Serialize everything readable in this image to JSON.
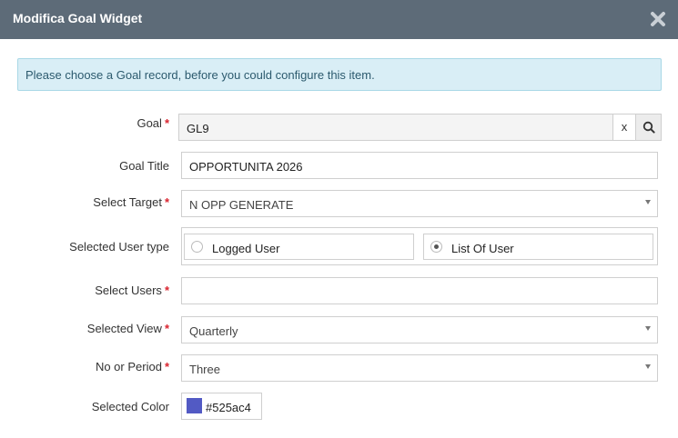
{
  "dialog": {
    "title": "Modifica Goal Widget",
    "alert": "Please choose a Goal record, before you could configure this item."
  },
  "form": {
    "goal": {
      "label": "Goal",
      "value": "GL9",
      "clear": "x"
    },
    "goal_title": {
      "label": "Goal Title",
      "value": "OPPORTUNITA 2026"
    },
    "select_target": {
      "label": "Select Target",
      "value": "N OPP GENERATE"
    },
    "user_type": {
      "label": "Selected User type",
      "options": [
        {
          "label": "Logged User",
          "selected": false
        },
        {
          "label": "List Of User",
          "selected": true
        }
      ]
    },
    "select_users": {
      "label": "Select Users",
      "value": ""
    },
    "selected_view": {
      "label": "Selected View",
      "value": "Quarterly"
    },
    "no_of_period": {
      "label": "No or Period",
      "value": "Three"
    },
    "selected_color": {
      "label": "Selected Color",
      "value": "#525ac4"
    }
  },
  "colors": {
    "header": "#5d6b78",
    "alert_bg": "#d9eef6",
    "required": "#d9232e",
    "swatch": "#525ac4"
  },
  "icons": {
    "close": "close-icon",
    "search": "search-icon",
    "caret": "chevron-down-icon"
  }
}
